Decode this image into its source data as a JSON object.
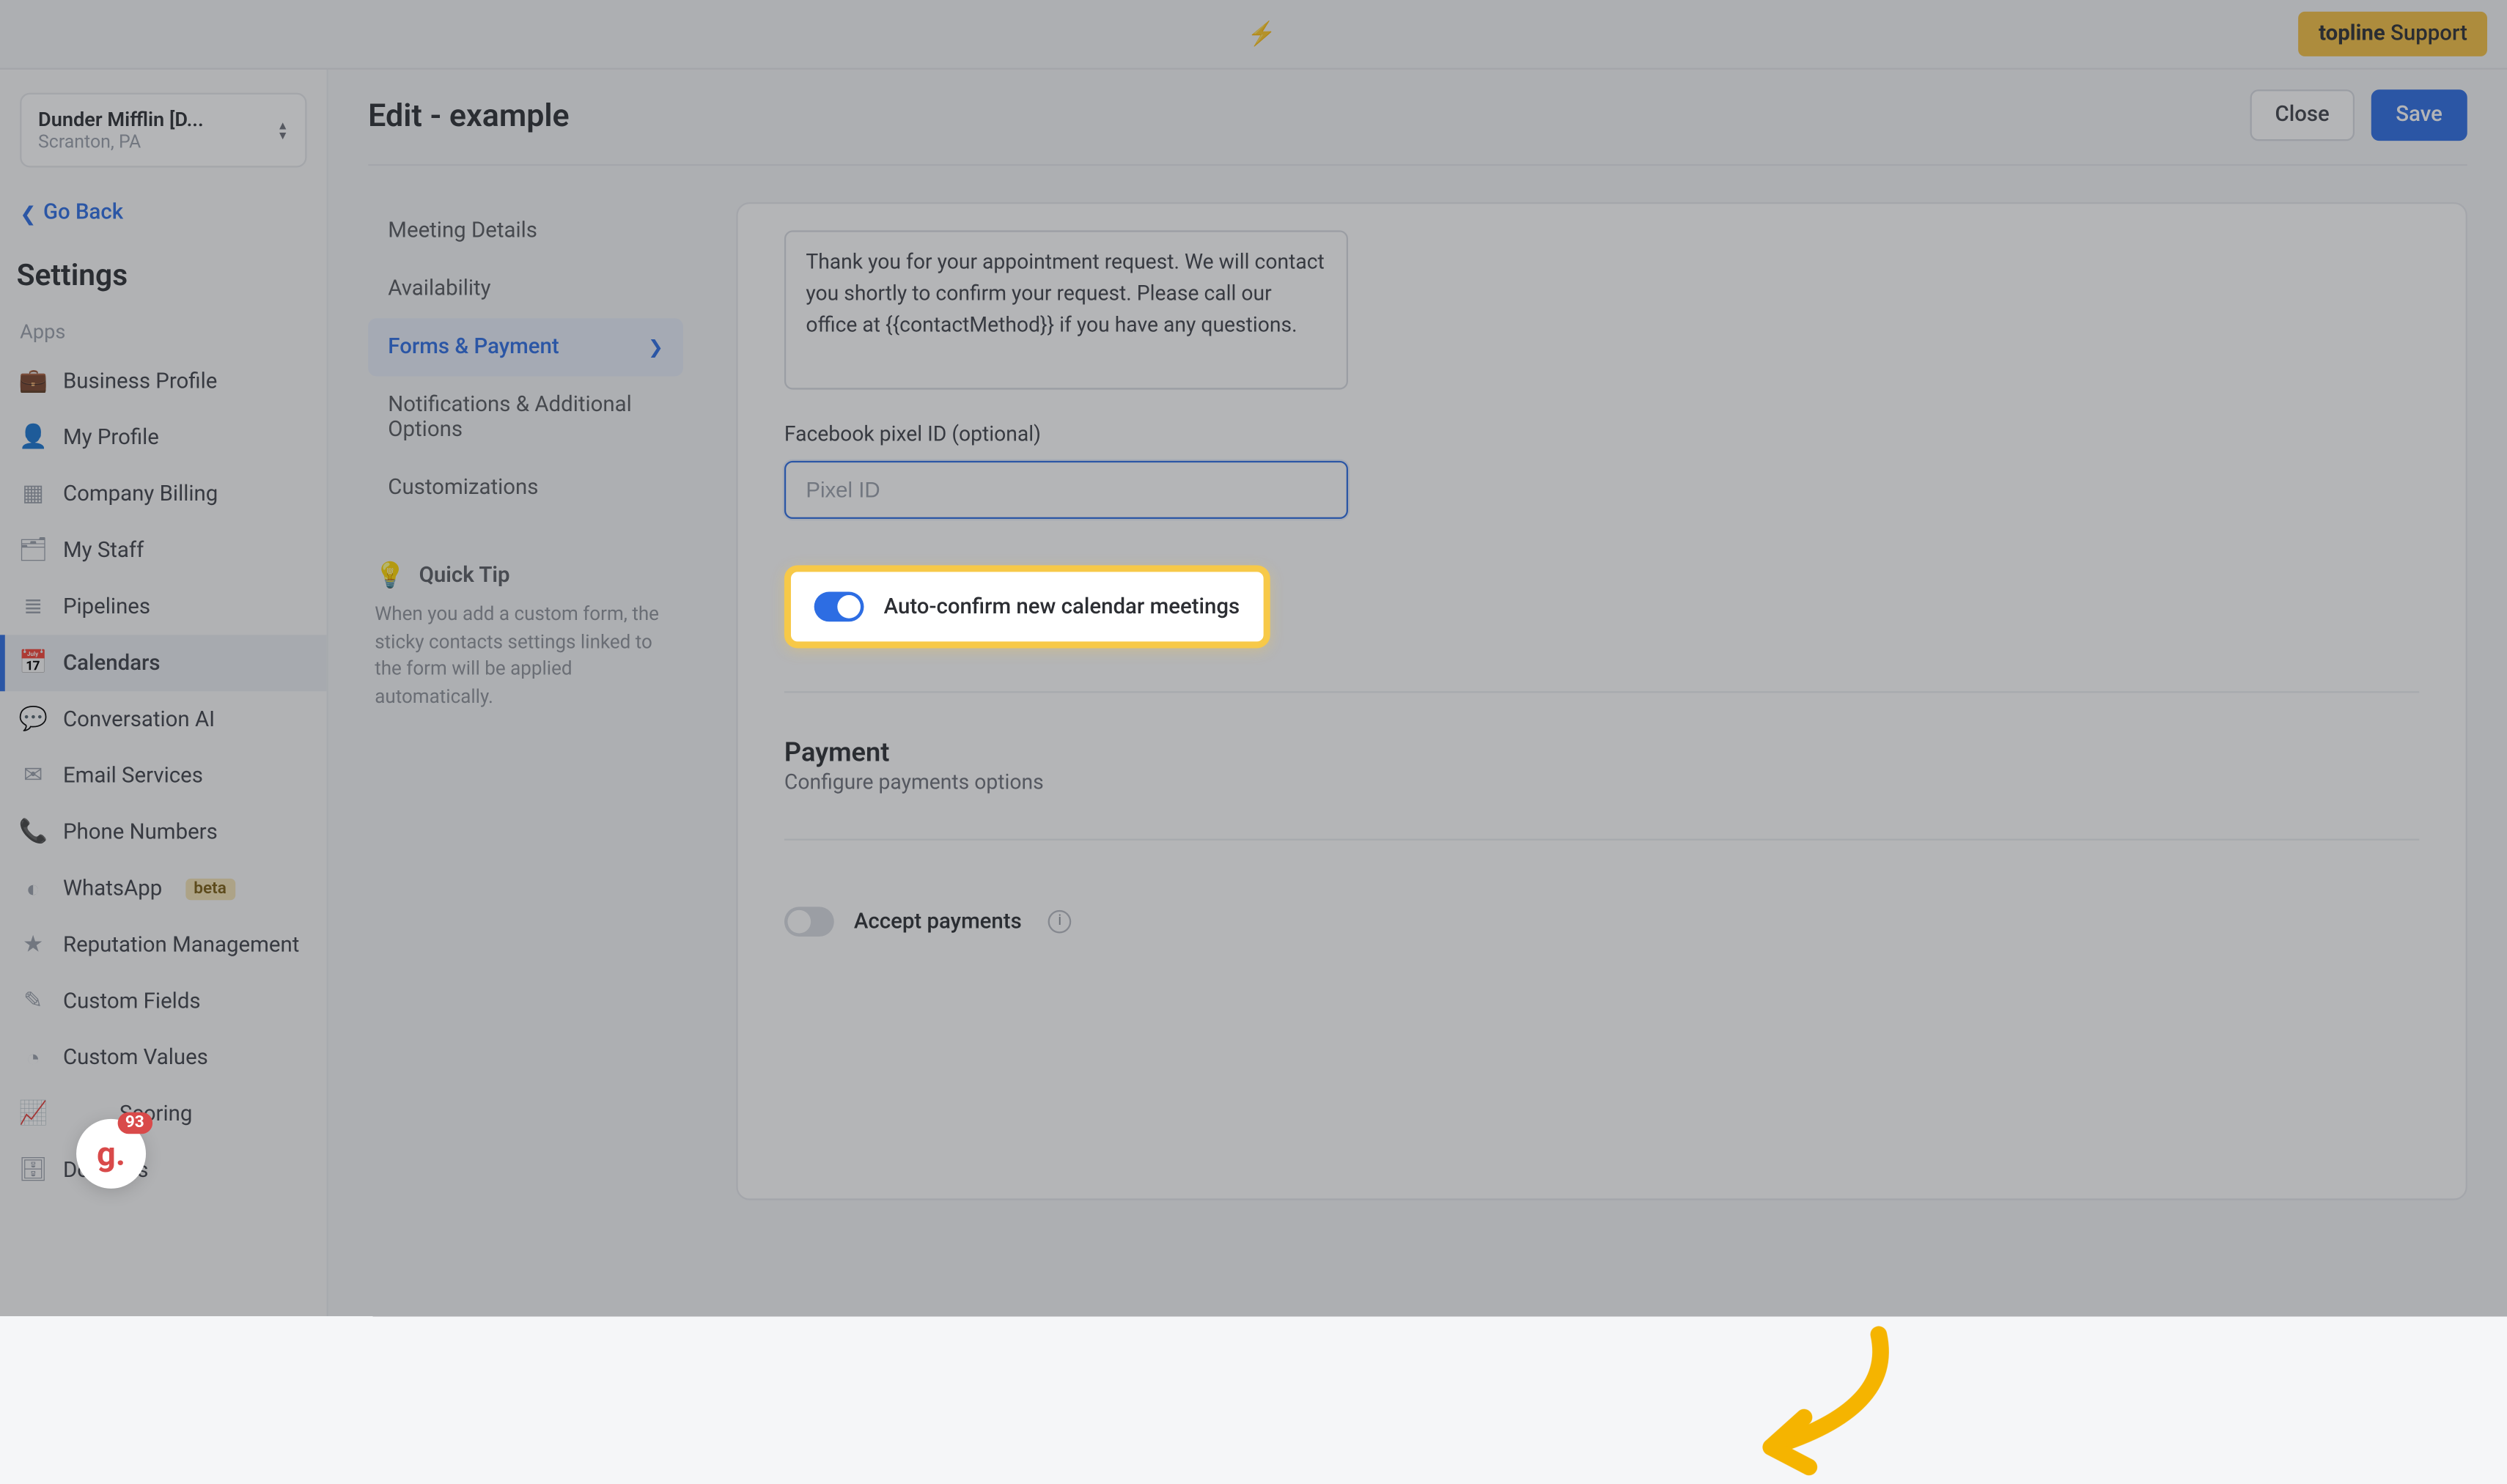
{
  "topbar": {
    "center_text": "",
    "support_prefix": "topline",
    "support_text": " Support"
  },
  "org": {
    "name": "Dunder Mifflin [D...",
    "location": "Scranton, PA"
  },
  "go_back": "Go Back",
  "settings_title": "Settings",
  "side_section": "Apps",
  "sidebar": {
    "items": [
      {
        "icon": "💼",
        "label": "Business Profile"
      },
      {
        "icon": "👤",
        "label": "My Profile"
      },
      {
        "icon": "▦",
        "label": "Company Billing"
      },
      {
        "icon": "🗂",
        "label": "My Staff"
      },
      {
        "icon": "≣",
        "label": "Pipelines"
      },
      {
        "icon": "📅",
        "label": "Calendars"
      },
      {
        "icon": "💬",
        "label": "Conversation AI"
      },
      {
        "icon": "✉",
        "label": "Email Services"
      },
      {
        "icon": "📞",
        "label": "Phone Numbers"
      },
      {
        "icon": "◐",
        "label": "WhatsApp",
        "beta": "beta"
      },
      {
        "icon": "★",
        "label": "Reputation Management"
      },
      {
        "icon": "✎",
        "label": "Custom Fields"
      },
      {
        "icon": "◔",
        "label": "Custom Values"
      },
      {
        "icon": "📈",
        "label": "Scoring",
        "obscured": true
      },
      {
        "icon": "🗄",
        "label": "Domains"
      }
    ]
  },
  "page": {
    "title": "Edit - example",
    "close": "Close",
    "save": "Save"
  },
  "tabs": [
    {
      "label": "Meeting Details"
    },
    {
      "label": "Availability"
    },
    {
      "label": "Forms & Payment",
      "active": true
    },
    {
      "label": "Notifications & Additional Options"
    },
    {
      "label": "Customizations"
    }
  ],
  "tip": {
    "title": "Quick Tip",
    "body": "When you add a custom form, the sticky contacts settings linked to the form will be applied automatically."
  },
  "form": {
    "thank_you": "Thank you for your appointment request. We will contact you shortly to confirm your request. Please call our office at {{contactMethod}} if you have any questions.",
    "pixel_label": "Facebook pixel ID (optional)",
    "pixel_placeholder": "Pixel ID",
    "auto_confirm_label": "Auto-confirm new calendar meetings",
    "payment_title": "Payment",
    "payment_sub": "Configure payments options",
    "accept_label": "Accept payments"
  },
  "float": {
    "glyph": "g.",
    "count": "93"
  }
}
